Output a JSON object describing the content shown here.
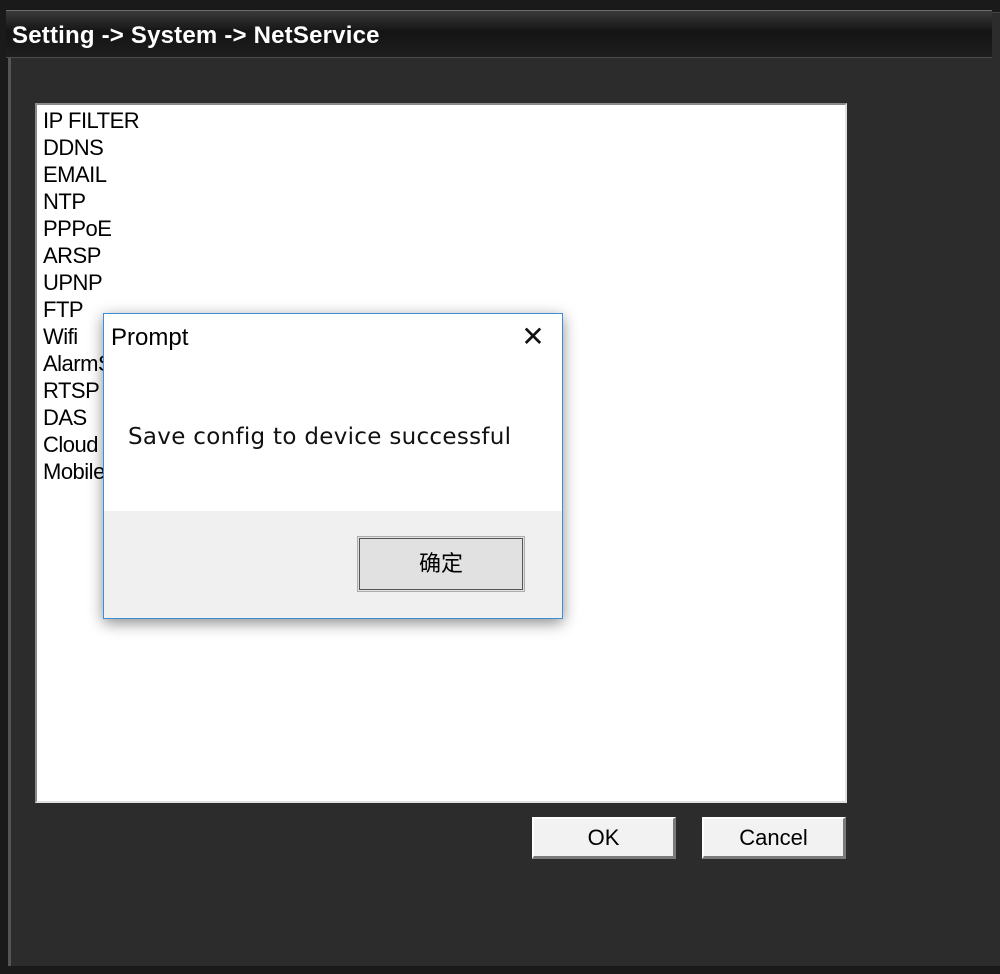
{
  "window": {
    "title": "Setting -> System -> NetService"
  },
  "netservice_list": {
    "items": [
      "IP FILTER",
      "DDNS",
      "EMAIL",
      "NTP",
      "PPPoE",
      "ARSP",
      "UPNP",
      "FTP",
      "Wifi",
      "AlarmS",
      "RTSP",
      "DAS",
      "Cloud",
      "Mobile"
    ]
  },
  "buttons": {
    "ok_label": "OK",
    "cancel_label": "Cancel"
  },
  "prompt_dialog": {
    "title": "Prompt",
    "close_glyph": "✕",
    "message": "Save config to device successful",
    "confirm_label": "确定"
  },
  "colors": {
    "window_bg": "#2c2c2c",
    "dialog_border": "#3c8fd6"
  }
}
